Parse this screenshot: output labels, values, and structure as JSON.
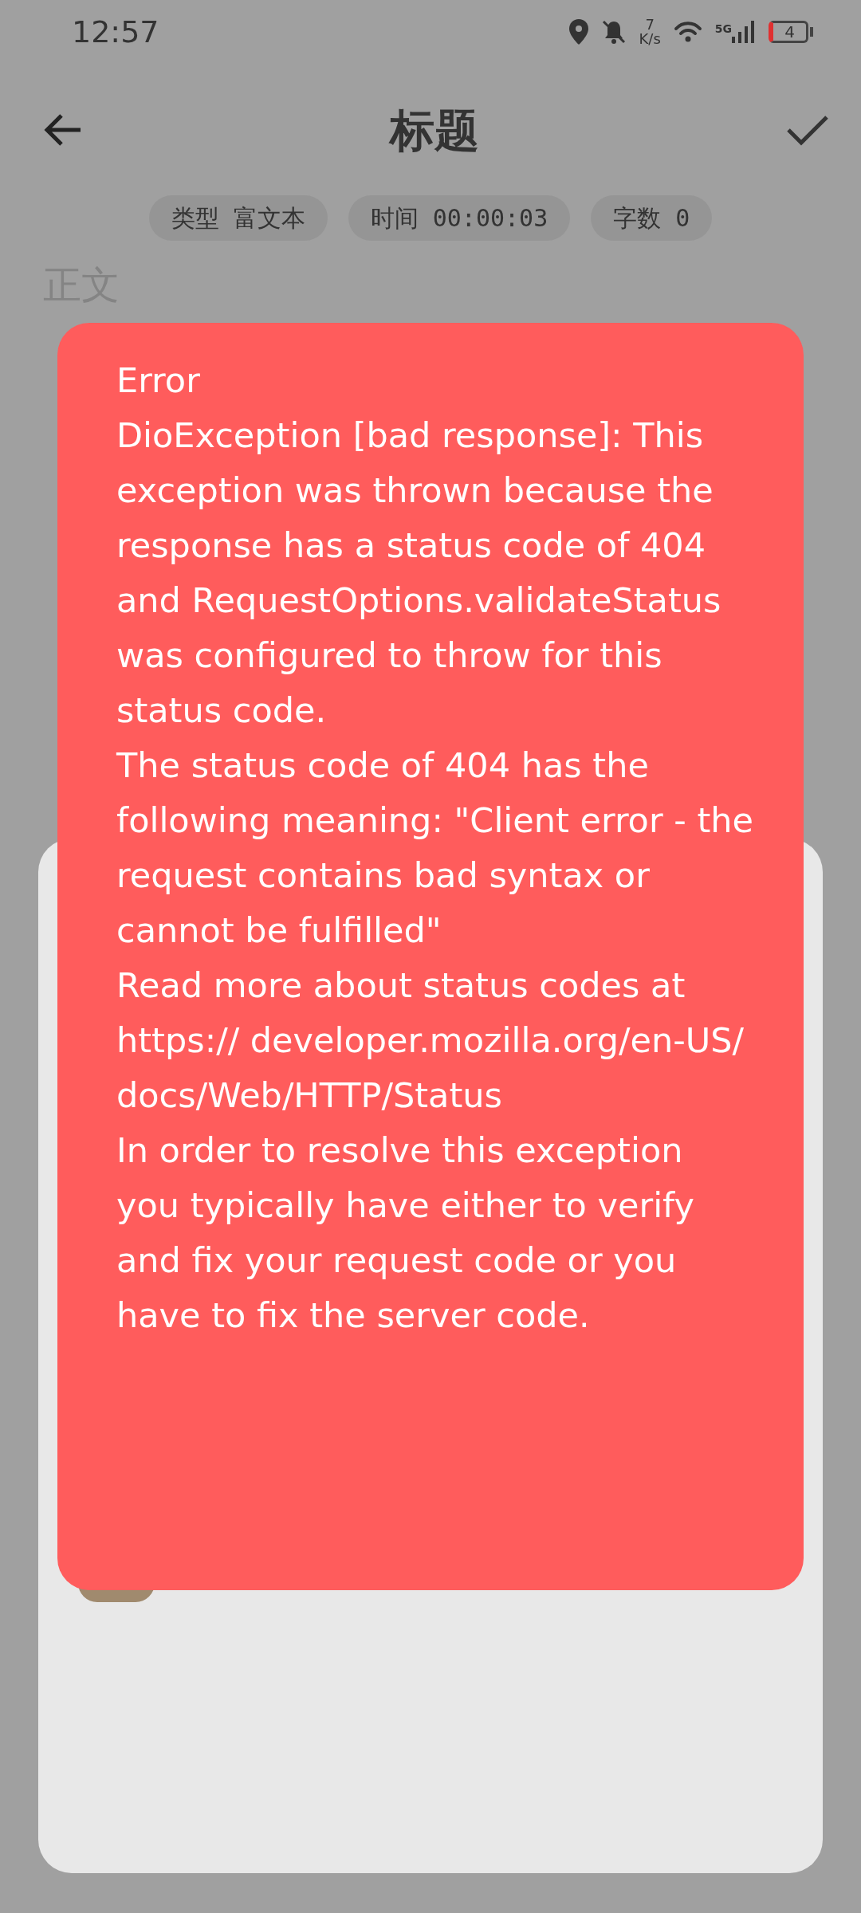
{
  "status_bar": {
    "time": "12:57",
    "net_speed_value": "7",
    "net_speed_unit": "K/s",
    "network_type": "5G",
    "battery": "4"
  },
  "app_bar": {
    "title": "标题"
  },
  "chips": [
    {
      "label": "类型",
      "value": "富文本"
    },
    {
      "label": "时间",
      "value": "00:00:03"
    },
    {
      "label": "字数",
      "value": "0"
    }
  ],
  "body_field": {
    "placeholder": "正文"
  },
  "toast": {
    "title": "Error",
    "lines": [
      "DioException [bad response]: This exception was thrown because the response has a status code of 404 and RequestOptions.validateStatus was configured to throw for this status code.",
      "The status code of 404 has the following meaning: \"Client error - the request contains bad syntax or cannot be fulfilled\"",
      "Read more about status codes at https:// developer.mozilla.org/en-US/ docs/Web/HTTP/Status",
      "In order to resolve this exception you typically have either to verify and fix your request code or you have to fix the server code."
    ]
  }
}
